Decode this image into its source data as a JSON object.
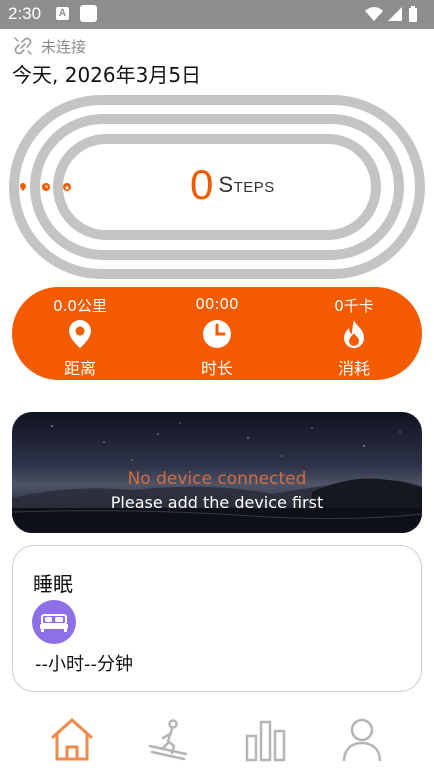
{
  "status_bar": {
    "time": "2:30",
    "notification_icon_letter": "A"
  },
  "connection": {
    "icon": "link-broken-icon",
    "label": "未连接"
  },
  "date_label": "今天, 2026年3月5日",
  "steps": {
    "count": "0",
    "unit": "Steps",
    "progress": 0
  },
  "stats": [
    {
      "value": "0.0公里",
      "label": "距离",
      "icon": "location-pin-icon"
    },
    {
      "value": "00:00",
      "label": "时长",
      "icon": "clock-icon"
    },
    {
      "value": "0千卡",
      "label": "消耗",
      "icon": "flame-icon"
    }
  ],
  "device_banner": {
    "title": "No device connected",
    "subtitle": "Please add the device first"
  },
  "sleep": {
    "title": "睡眠",
    "icon": "bed-icon",
    "duration": "--小时--分钟"
  },
  "bottom_nav": [
    {
      "name": "home",
      "icon": "home-icon",
      "active": true
    },
    {
      "name": "sport",
      "icon": "treadmill-icon",
      "active": false
    },
    {
      "name": "data",
      "icon": "bar-chart-icon",
      "active": false
    },
    {
      "name": "profile",
      "icon": "person-icon",
      "active": false
    }
  ],
  "colors": {
    "accent": "#f45b00",
    "track": "#c4c4c4",
    "sleep_icon": "#8d6fe8",
    "nav_active": "#f08a4b",
    "nav_inactive": "#b5b5b5"
  }
}
